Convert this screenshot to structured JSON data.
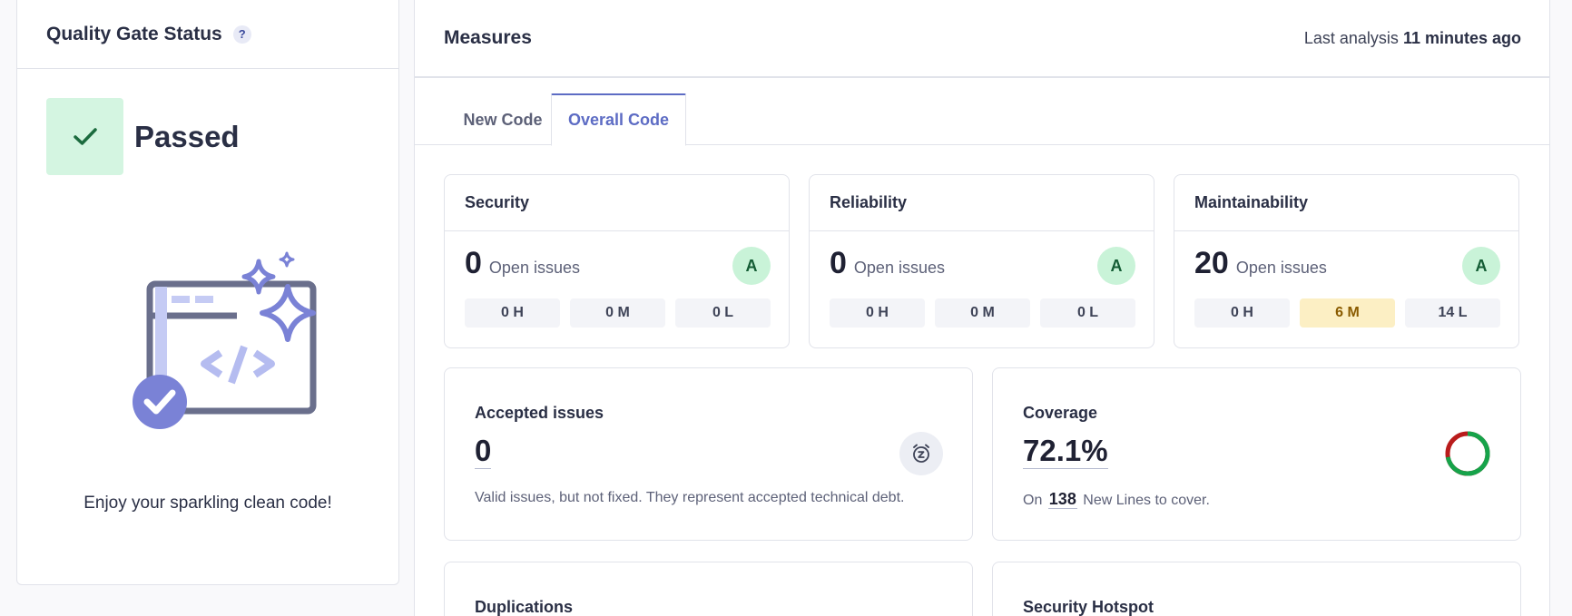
{
  "quality_gate": {
    "title": "Quality Gate Status",
    "help_glyph": "?",
    "status": "Passed",
    "message": "Enjoy your sparkling clean code!"
  },
  "measures": {
    "title": "Measures",
    "last_analysis_label": "Last analysis",
    "last_analysis_value": "11 minutes ago",
    "tabs": [
      {
        "label": "New Code",
        "active": false
      },
      {
        "label": "Overall Code",
        "active": true
      }
    ],
    "ratings": [
      {
        "title": "Security",
        "count": "0",
        "count_label": "Open issues",
        "grade": "A",
        "severities": [
          "0 H",
          "0 M",
          "0 L"
        ]
      },
      {
        "title": "Reliability",
        "count": "0",
        "count_label": "Open issues",
        "grade": "A",
        "severities": [
          "0 H",
          "0 M",
          "0 L"
        ]
      },
      {
        "title": "Maintainability",
        "count": "20",
        "count_label": "Open issues",
        "grade": "A",
        "severities": [
          "0 H",
          "6 M",
          "14 L"
        ]
      }
    ],
    "accepted": {
      "title": "Accepted issues",
      "value": "0",
      "description": "Valid issues, but not fixed. They represent accepted technical debt."
    },
    "coverage": {
      "title": "Coverage",
      "value": "72.1%",
      "percent": 72.1,
      "desc_prefix": "On",
      "lines": "138",
      "desc_suffix": "New Lines to cover."
    },
    "duplications": {
      "title": "Duplications"
    },
    "hotspot": {
      "title": "Security Hotspot"
    }
  },
  "colors": {
    "accent": "#5d6cc4",
    "pass_bg": "#d4f5e1",
    "pass_fg": "#1b6b3e",
    "grade_bg": "#c9f3d8",
    "coverage_good": "#16a34a",
    "coverage_bad": "#b91c1c",
    "warn_bg": "#fcefc4"
  }
}
